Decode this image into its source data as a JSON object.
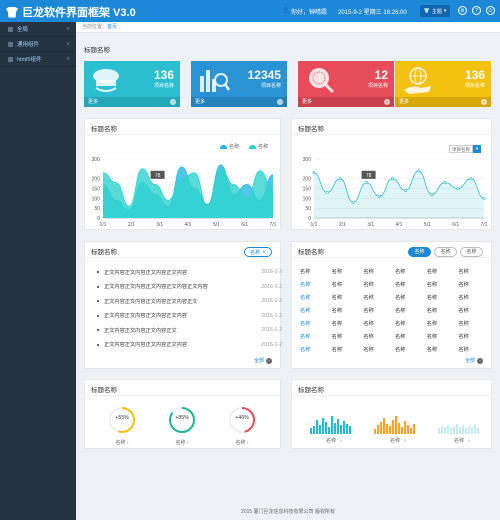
{
  "header": {
    "title": "巨龙软件界面框架 V3.0",
    "greeting": "你好，钟晴霞",
    "datetime": "2015-9-2  星期三  16:26:00",
    "theme_label": "主题",
    "help": "?",
    "power": "⏻"
  },
  "sidebar": {
    "items": [
      {
        "label": "全局"
      },
      {
        "label": "通用组件"
      },
      {
        "label": "html5组件"
      }
    ]
  },
  "breadcrumb": {
    "prefix": "当前位置：",
    "current": "首页"
  },
  "page_title": "标题名称",
  "tiles": [
    {
      "value": "136",
      "label": "项目名称",
      "more": "更多",
      "color": "#2bbfd0",
      "icon": "police-cap-icon"
    },
    {
      "value": "12345",
      "label": "项目名称",
      "more": "更多",
      "color": "#2a93d6",
      "icon": "bar-chart-search-icon"
    },
    {
      "value": "12",
      "label": "项目名称",
      "more": "更多",
      "color": "#e84c5b",
      "icon": "globe-magnifier-icon"
    },
    {
      "value": "136",
      "label": "项目名称",
      "more": "更多",
      "color": "#f3c10f",
      "icon": "hand-globe-icon"
    }
  ],
  "chart_left": {
    "title": "标题名称",
    "legend": [
      "名称",
      "名称"
    ],
    "tooltip": "78"
  },
  "chart_right": {
    "title": "标题名称",
    "select": "项目名称",
    "select_arrow": "▾",
    "tooltip": "78"
  },
  "chart_data": [
    {
      "type": "area",
      "categories": [
        "1/1",
        "2/1",
        "3/1",
        "4/1",
        "5/1",
        "6/1",
        "7/1"
      ],
      "ylim": [
        0,
        300
      ],
      "yticks": [
        "300",
        "200",
        "150",
        "100",
        "50",
        "0"
      ],
      "series": [
        {
          "name": "名称",
          "color": "#25b6e6",
          "values": [
            170,
            90,
            40,
            180,
            120,
            60,
            260,
            150,
            70,
            270,
            120,
            170,
            90,
            220
          ]
        },
        {
          "name": "名称",
          "color": "#2fd3cd",
          "values": [
            230,
            180,
            60,
            250,
            170,
            90,
            200,
            230,
            60,
            250,
            170,
            100,
            240,
            150
          ]
        }
      ]
    },
    {
      "type": "area",
      "categories": [
        "1/1",
        "2/1",
        "3/1",
        "4/1",
        "5/1",
        "6/1",
        "7/1"
      ],
      "ylim": [
        0,
        300
      ],
      "yticks": [
        "300",
        "200",
        "150",
        "100",
        "50",
        "0"
      ],
      "series": [
        {
          "color": "#2fb9cf",
          "values": [
            230,
            130,
            200,
            80,
            180,
            110,
            200,
            140,
            240,
            120,
            180,
            150,
            200,
            100
          ]
        }
      ]
    }
  ],
  "news": {
    "title": "标题名称",
    "button": "名称",
    "items": [
      {
        "text": "正文内容正文内容正文内容正文内容",
        "date": "2016-1-2"
      },
      {
        "text": "正文内容正文内容正文内容正文内容正文内容",
        "date": "2016-1-2"
      },
      {
        "text": "正文内容正文内容正文内容正文内容正文",
        "date": "2016-1-2"
      },
      {
        "text": "正文内容正文内容正文内容正文内容",
        "date": "2016-1-2"
      },
      {
        "text": "正文内容正文内容正文内容正文",
        "date": "2016-1-2"
      },
      {
        "text": "正文内容正文内容正文内容正文内容",
        "date": "2016-1-2"
      }
    ],
    "all": "全部"
  },
  "table": {
    "title": "标题名称",
    "tabs": [
      "名称",
      "名称",
      "名称"
    ],
    "header": [
      "名称",
      "名称",
      "名称",
      "名称",
      "名称",
      "名称"
    ],
    "rows": [
      [
        "名称",
        "名称",
        "名称",
        "名称",
        "名称",
        "名称"
      ],
      [
        "名称",
        "名称",
        "名称",
        "名称",
        "名称",
        "名称"
      ],
      [
        "名称",
        "名称",
        "名称",
        "名称",
        "名称",
        "名称"
      ],
      [
        "名称",
        "名称",
        "名称",
        "名称",
        "名称",
        "名称"
      ],
      [
        "名称",
        "名称",
        "名称",
        "名称",
        "名称",
        "名称"
      ],
      [
        "名称",
        "名称",
        "名称",
        "名称",
        "名称",
        "名称"
      ]
    ],
    "all": "全部"
  },
  "gauges": {
    "title": "标题名称",
    "items": [
      {
        "pct": "+55%",
        "value": 0.55,
        "label": "名称",
        "color": "#f3c10f"
      },
      {
        "pct": "+85%",
        "value": 0.85,
        "label": "名称",
        "color": "#1eb59a"
      },
      {
        "pct": "+46%",
        "value": 0.46,
        "label": "名称",
        "color": "#e84c5b"
      }
    ]
  },
  "bars": {
    "title": "标题名称",
    "labels": [
      "名称",
      "名称",
      "名称"
    ],
    "colors": [
      "#2bb8d0",
      "#f3a52b",
      "#c8ecee"
    ],
    "groups": [
      [
        6,
        8,
        14,
        9,
        16,
        12,
        7,
        18,
        11,
        15,
        9,
        13,
        10,
        8
      ],
      [
        5,
        9,
        12,
        16,
        10,
        8,
        14,
        18,
        11,
        7,
        13,
        9,
        6,
        10
      ],
      [
        6,
        8,
        7,
        9,
        6,
        8,
        10,
        7,
        9,
        6,
        8,
        7,
        9,
        6
      ]
    ]
  },
  "footer": "2015  厦门巨龙信息科技有限公司  版权所有"
}
